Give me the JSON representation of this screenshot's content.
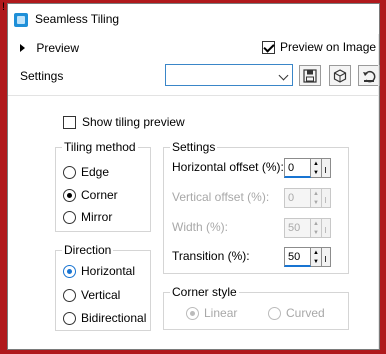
{
  "window": {
    "title": "Seamless Tiling"
  },
  "preview": {
    "label": "Preview",
    "on_image_label": "Preview on Image",
    "on_image_checked": true
  },
  "settings_bar": {
    "label": "Settings",
    "preset_value": ""
  },
  "show_tiling": {
    "label": "Show tiling preview",
    "checked": false
  },
  "tiling_method": {
    "title": "Tiling method",
    "options": [
      {
        "label": "Edge",
        "selected": false
      },
      {
        "label": "Corner",
        "selected": true
      },
      {
        "label": "Mirror",
        "selected": false
      }
    ]
  },
  "direction": {
    "title": "Direction",
    "options": [
      {
        "label": "Horizontal",
        "selected": true
      },
      {
        "label": "Vertical",
        "selected": false
      },
      {
        "label": "Bidirectional",
        "selected": false
      }
    ]
  },
  "settings_group": {
    "title": "Settings",
    "fields": [
      {
        "label": "Horizontal offset (%):",
        "value": "0",
        "enabled": true
      },
      {
        "label": "Vertical offset (%):",
        "value": "0",
        "enabled": false
      },
      {
        "label": "Width (%):",
        "value": "50",
        "enabled": false
      },
      {
        "label": "Transition (%):",
        "value": "50",
        "enabled": true
      }
    ]
  },
  "corner_style": {
    "title": "Corner style",
    "options": [
      {
        "label": "Linear",
        "selected": true,
        "enabled": false
      },
      {
        "label": "Curved",
        "selected": false,
        "enabled": false
      }
    ]
  },
  "colors": {
    "background": "#b0191c",
    "accent": "#1874d2",
    "border": "#d5d5d5"
  },
  "icons": [
    "app-icon",
    "save-preset-icon",
    "delete-preset-icon",
    "reset-icon"
  ]
}
